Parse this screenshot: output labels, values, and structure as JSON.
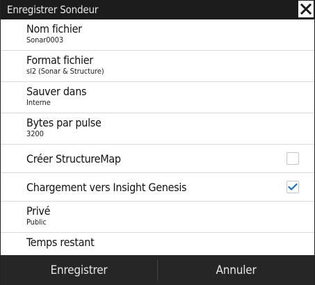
{
  "dialog": {
    "title": "Enregistrer Sondeur",
    "close_icon": "close-icon"
  },
  "rows": [
    {
      "label": "Nom fichier",
      "value": "Sonar0003"
    },
    {
      "label": "Format fichier",
      "value": "sl2 (Sonar & Structure)"
    },
    {
      "label": "Sauver dans",
      "value": "Interne"
    },
    {
      "label": "Bytes par pulse",
      "value": "3200"
    },
    {
      "label": "Créer StructureMap",
      "checked": false
    },
    {
      "label": "Chargement vers Insight Genesis",
      "checked": true
    },
    {
      "label": "Privé",
      "value": "Public"
    },
    {
      "label": "Temps restant"
    }
  ],
  "footer": {
    "save_label": "Enregistrer",
    "cancel_label": "Annuler"
  },
  "colors": {
    "titlebar": "#1c1c1c",
    "footer": "#262626",
    "check_accent": "#1a6fb5"
  }
}
